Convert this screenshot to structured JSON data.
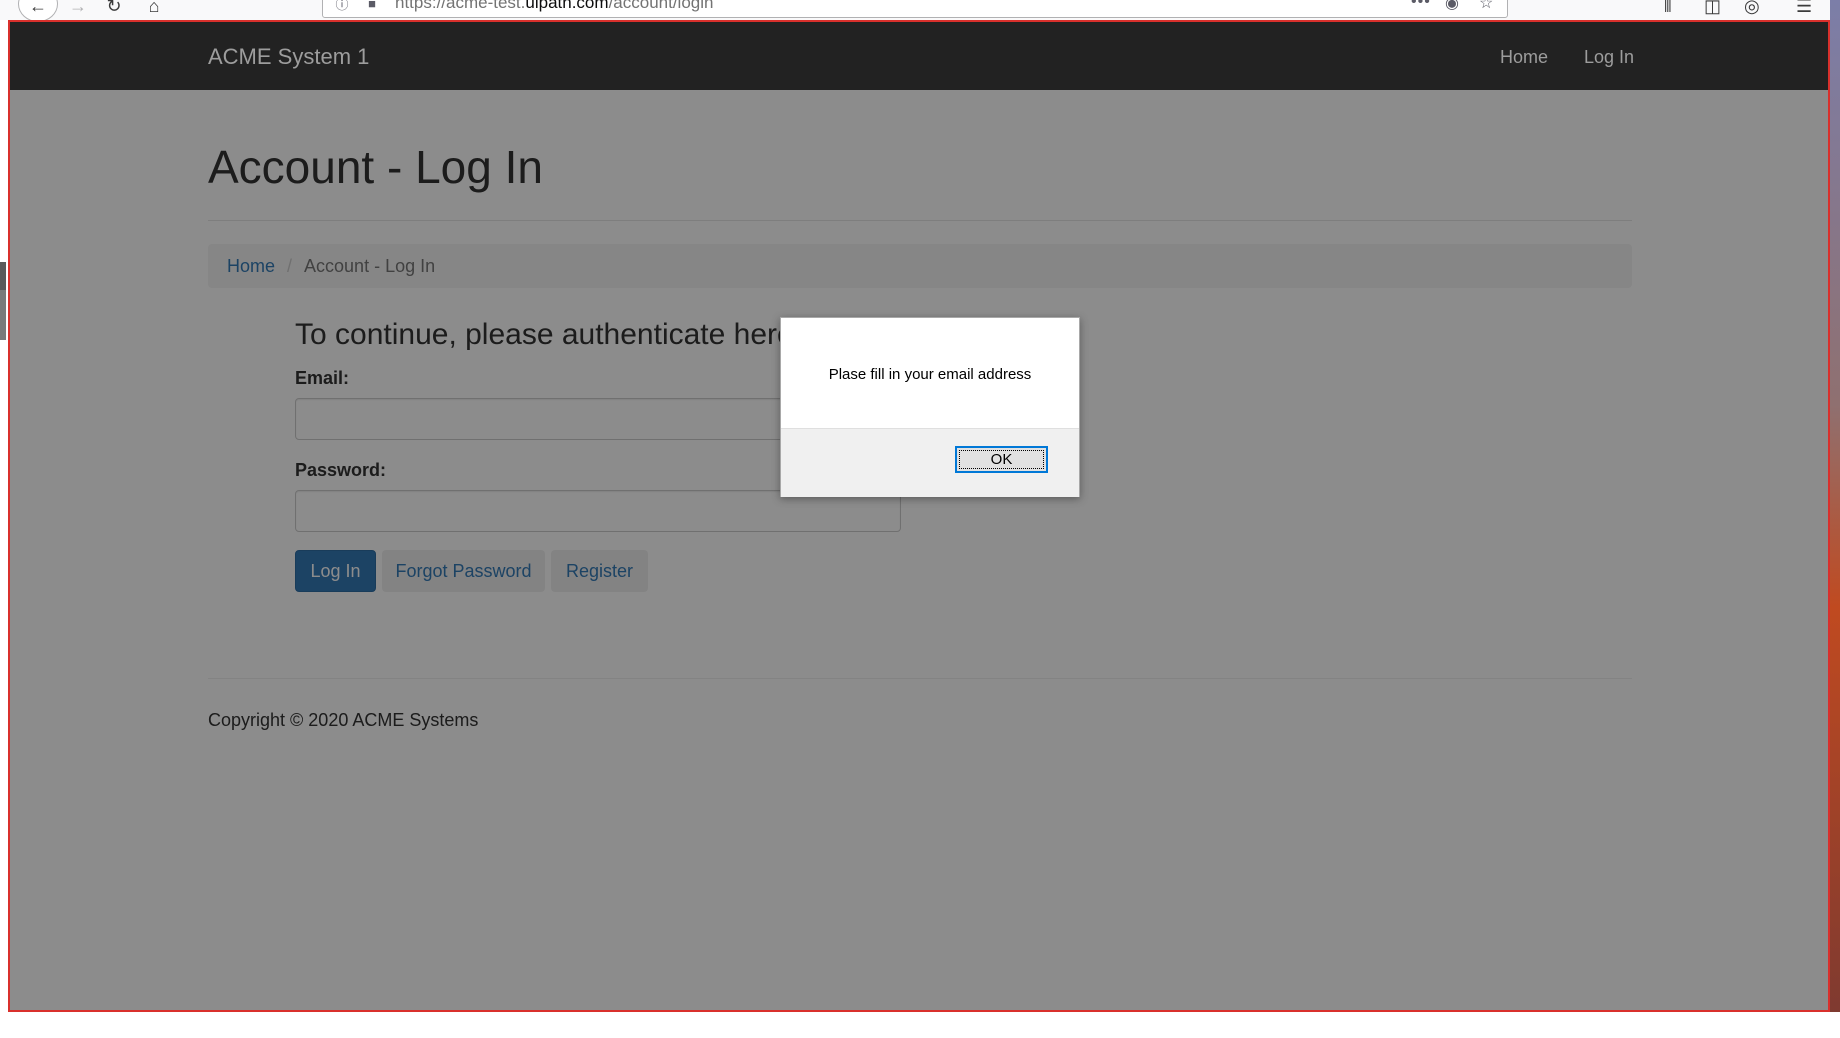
{
  "browser": {
    "url_prefix": "https://acme-test.",
    "url_domain": "uipath.com",
    "url_path": "/account/login"
  },
  "site": {
    "brand": "ACME System 1",
    "nav": {
      "home": "Home",
      "login": "Log In"
    }
  },
  "page": {
    "title": "Account - Log In",
    "breadcrumb": {
      "home": "Home",
      "separator": "/",
      "current": "Account - Log In"
    }
  },
  "form": {
    "heading": "To continue, please authenticate here",
    "email_label": "Email:",
    "email_value": "",
    "password_label": "Password:",
    "password_value": "",
    "login_button": "Log In",
    "forgot_button": "Forgot Password",
    "register_button": "Register"
  },
  "footer": {
    "copyright": "Copyright © 2020 ACME Systems"
  },
  "alert": {
    "message": "Plase fill in your email address",
    "ok_button": "OK"
  },
  "colors": {
    "navbar": "#222222",
    "primary": "#337ab7",
    "frame_border": "#d9302c"
  }
}
